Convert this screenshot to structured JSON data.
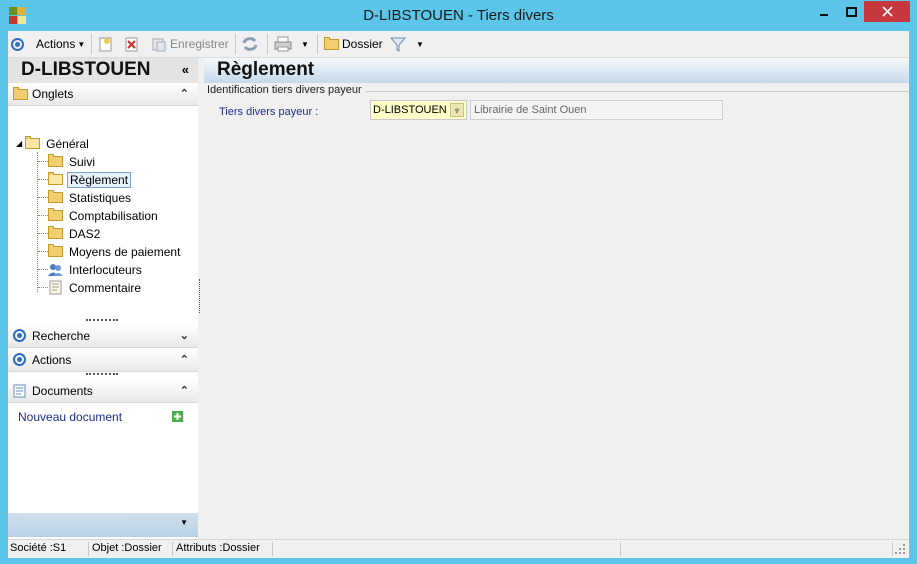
{
  "window": {
    "title": "D-LIBSTOUEN -  Tiers divers",
    "colors": {
      "frame": "#5bc6ea",
      "close": "#c7383d"
    }
  },
  "toolbar": {
    "actions_label": "Actions",
    "save_label": "Enregistrer",
    "dossier_label": "Dossier"
  },
  "left_panel": {
    "title": "D-LIBSTOUEN",
    "sections": {
      "onglets": "Onglets",
      "recherche": "Recherche",
      "actions": "Actions",
      "documents": "Documents"
    },
    "tree": {
      "root": "Général",
      "items": [
        "Suivi",
        "Règlement",
        "Statistiques",
        "Comptabilisation",
        "DAS2",
        "Moyens de paiement",
        "Interlocuteurs",
        "Commentaire"
      ]
    },
    "new_document_link": "Nouveau document"
  },
  "main": {
    "title": "Règlement",
    "group_title": "Identification tiers divers payeur",
    "field_label": "Tiers divers payeur :",
    "field_code": "D-LIBSTOUEN",
    "field_description": "Librairie de  Saint Ouen"
  },
  "statusbar": {
    "societe": "Société :S1",
    "objet": "Objet :Dossier",
    "attributs": "Attributs :Dossier"
  }
}
